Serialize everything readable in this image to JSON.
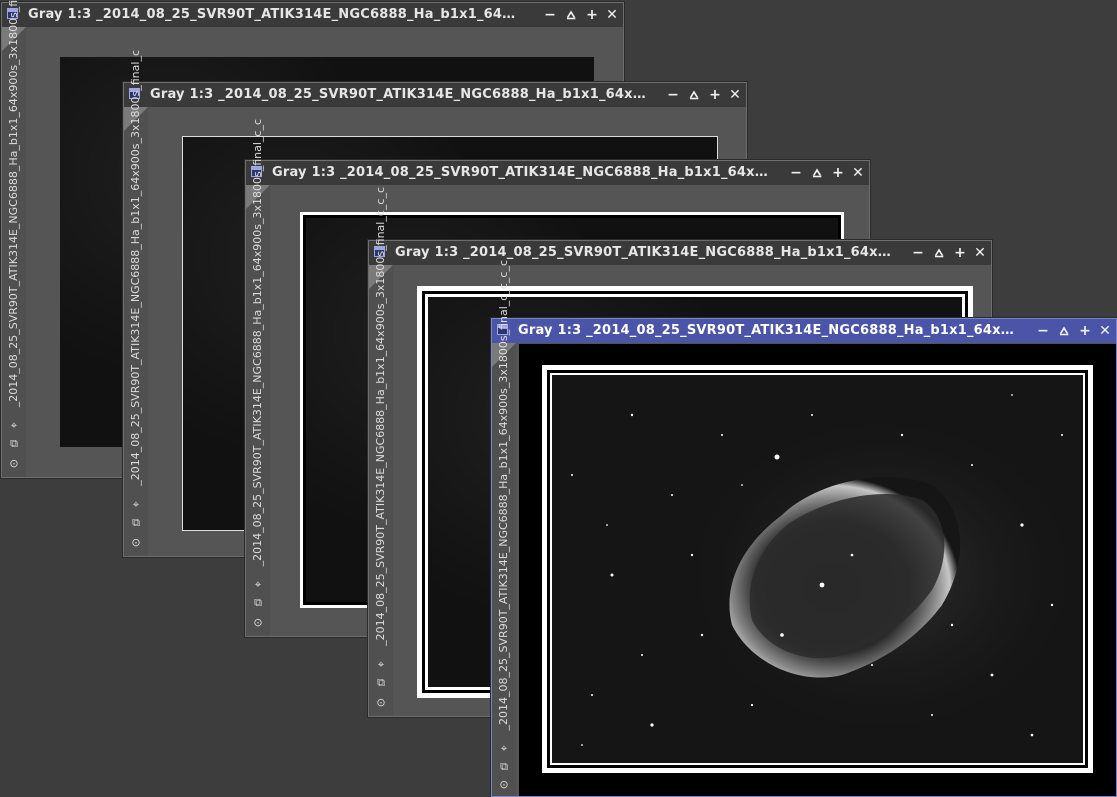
{
  "windows": [
    {
      "title": "Gray 1:3 _2014_08_25_SVR90T_ATIK314E_NGC6888_Ha_b1x1_64x...",
      "side_label": "_2014_08_25_SVR90T_ATIK314E_NGC6888_Ha_b1x1_64x900s_3x1800s_final",
      "active": false
    },
    {
      "title": "Gray 1:3 _2014_08_25_SVR90T_ATIK314E_NGC6888_Ha_b1x1_64x...",
      "side_label": "_2014_08_25_SVR90T_ATIK314E_NGC6888_Ha_b1x1_64x900s_3x1800s_final_c",
      "active": false
    },
    {
      "title": "Gray 1:3 _2014_08_25_SVR90T_ATIK314E_NGC6888_Ha_b1x1_64x...",
      "side_label": "_2014_08_25_SVR90T_ATIK314E_NGC6888_Ha_b1x1_64x900s_3x1800s_final_c_c",
      "active": false
    },
    {
      "title": "Gray 1:3 _2014_08_25_SVR90T_ATIK314E_NGC6888_Ha_b1x1_64x...",
      "side_label": "_2014_08_25_SVR90T_ATIK314E_NGC6888_Ha_b1x1_64x900s_3x1800s_final_c_c_c",
      "active": false
    },
    {
      "title": "Gray 1:3 _2014_08_25_SVR90T_ATIK314E_NGC6888_Ha_b1x1_64x...",
      "side_label": "_2014_08_25_SVR90T_ATIK314E_NGC6888_Ha_b1x1_64x900s_3x1800s_final_c_c_c_c",
      "active": true
    }
  ],
  "titlebar_buttons": {
    "minimize": "−",
    "shade": "⩟",
    "maximize": "+",
    "close": "✕"
  },
  "colors": {
    "desktop": "#3d3d3d",
    "active_titlebar": "#4b55a8",
    "inactive_titlebar": "#3a3a3a"
  }
}
